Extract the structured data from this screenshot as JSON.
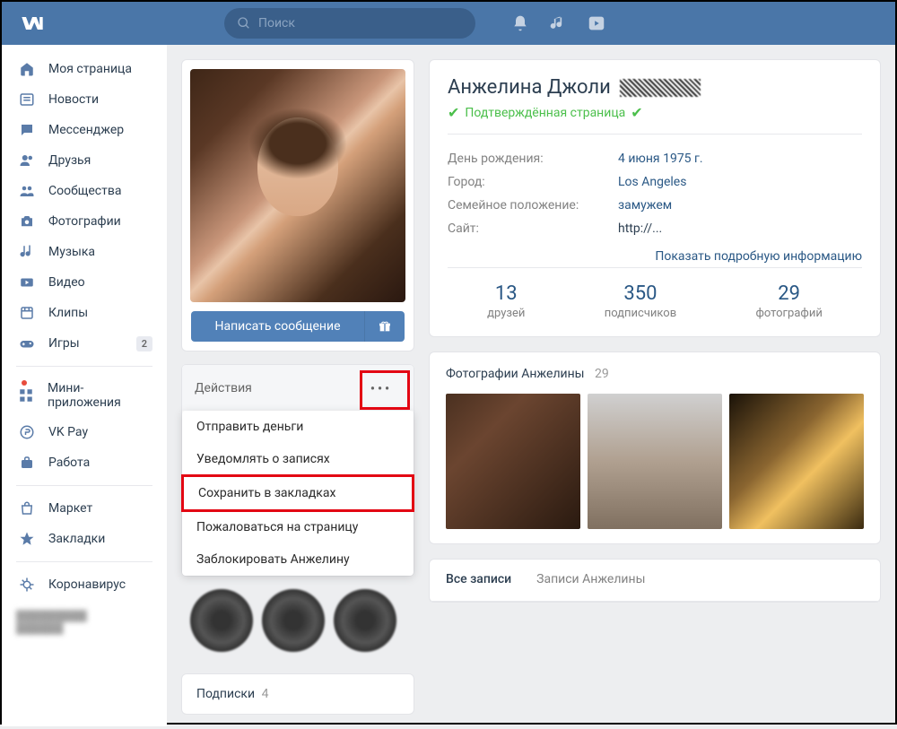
{
  "search": {
    "placeholder": "Поиск"
  },
  "sidebar": {
    "items": [
      {
        "label": "Моя страница",
        "icon": "home"
      },
      {
        "label": "Новости",
        "icon": "news"
      },
      {
        "label": "Мессенджер",
        "icon": "chat"
      },
      {
        "label": "Друзья",
        "icon": "friends"
      },
      {
        "label": "Сообщества",
        "icon": "groups"
      },
      {
        "label": "Фотографии",
        "icon": "camera"
      },
      {
        "label": "Музыка",
        "icon": "music"
      },
      {
        "label": "Видео",
        "icon": "video"
      },
      {
        "label": "Клипы",
        "icon": "clips"
      },
      {
        "label": "Игры",
        "icon": "games",
        "badge": "2"
      }
    ],
    "items2": [
      {
        "label": "Мини-приложения",
        "icon": "apps",
        "dot": true
      },
      {
        "label": "VK Pay",
        "icon": "pay"
      },
      {
        "label": "Работа",
        "icon": "job"
      }
    ],
    "items3": [
      {
        "label": "Маркет",
        "icon": "market"
      },
      {
        "label": "Закладки",
        "icon": "star"
      }
    ],
    "items4": [
      {
        "label": "Коронавирус",
        "icon": "virus"
      }
    ]
  },
  "profile": {
    "message_btn": "Написать сообщение",
    "actions_label": "Действия",
    "dropdown": [
      "Отправить деньги",
      "Уведомлять о записях",
      "Сохранить в закладках",
      "Пожаловаться на страницу",
      "Заблокировать Анжелину"
    ],
    "subs_title": "Подписки",
    "subs_count": "4"
  },
  "details": {
    "name": "Анжелина Джоли",
    "verified_text": "Подтверждённая страница",
    "info": [
      {
        "label": "День рождения:",
        "value": "4 июня 1975 г.",
        "link": true
      },
      {
        "label": "Город:",
        "value": "Los Angeles",
        "link": true
      },
      {
        "label": "Семейное положение:",
        "value": "замужем",
        "link": true
      },
      {
        "label": "Сайт:",
        "value": "http://...",
        "link": false
      }
    ],
    "more_info": "Показать подробную информацию",
    "stats": [
      {
        "num": "13",
        "label": "друзей"
      },
      {
        "num": "350",
        "label": "подписчиков"
      },
      {
        "num": "29",
        "label": "фотографий"
      }
    ]
  },
  "photos": {
    "title": "Фотографии Анжелины",
    "count": "29"
  },
  "wall": {
    "tab_all": "Все записи",
    "tab_own": "Записи Анжелины"
  }
}
